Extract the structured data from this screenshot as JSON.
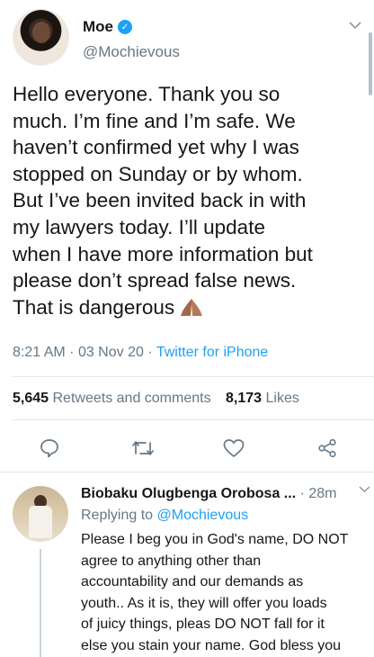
{
  "tweet": {
    "display_name": "Moe",
    "verified_icon": "verified-badge-icon",
    "handle": "@Mochievous",
    "text_lines": [
      "Hello everyone. Thank you so",
      "much. I’m fine and I’m safe. We",
      "haven’t confirmed yet why I was",
      "stopped on Sunday or by whom.",
      "But I’ve been invited back in with",
      "my lawyers today. I’ll update",
      "when I have more information but",
      "please don’t spread false news.",
      "That is dangerous"
    ],
    "emoji": "folded-hands-emoji",
    "time": "8:21 AM",
    "date": "03 Nov 20",
    "source": "Twitter for iPhone",
    "retweets_count": "5,645",
    "retweets_label": "Retweets and comments",
    "likes_count": "8,173",
    "likes_label": "Likes"
  },
  "actions": [
    "reply-icon",
    "retweet-icon",
    "like-icon",
    "share-icon"
  ],
  "reply": {
    "name": "Biobaku Olugbenga Orobosa ...",
    "time": "· 28m",
    "replying_to_label": "Replying to",
    "replying_to_handle": "@Mochievous",
    "text_lines": [
      "Please I beg you in God's name, DO NOT",
      "agree to anything other than",
      "accountability and our demands as",
      "youth.. As it is, they will offer you loads",
      "of juicy things, pleas DO NOT fall for it",
      "else you stain your name. God bless you"
    ]
  },
  "colors": {
    "accent": "#1da1f2",
    "secondary_text": "#657786",
    "divider": "#e1e8ed"
  }
}
